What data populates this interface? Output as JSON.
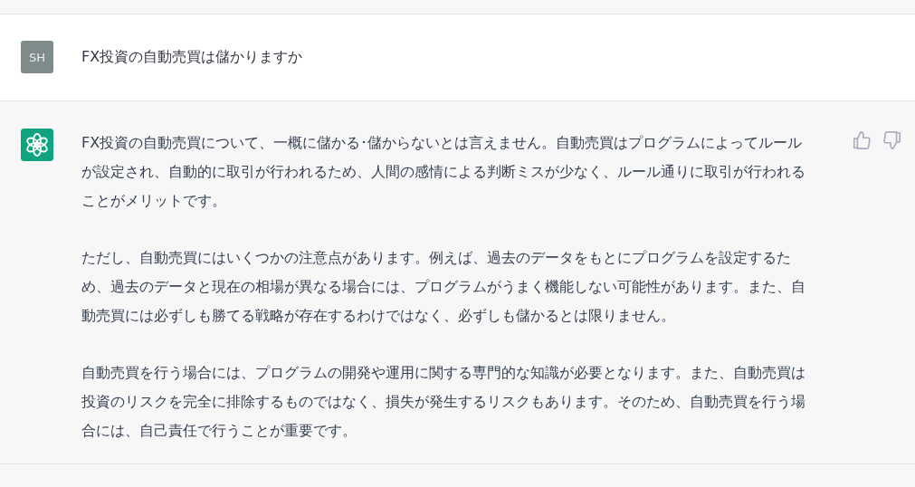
{
  "messages": [
    {
      "kind": "user",
      "avatar": "SH",
      "paragraphs": [
        "FX投資の自動売買は儲かりますか"
      ]
    },
    {
      "kind": "assistant",
      "paragraphs": [
        "FX投資の自動売買について、一概に儲かる･儲からないとは言えません。自動売買はプログラムによってルールが設定され、自動的に取引が行われるため、人間の感情による判断ミスが少なく、ルール通りに取引が行われることがメリットです。",
        "ただし、自動売買にはいくつかの注意点があります。例えば、過去のデータをもとにプログラムを設定するため、過去のデータと現在の相場が異なる場合には、プログラムがうまく機能しない可能性があります。また、自動売買には必ずしも勝てる戦略が存在するわけではなく、必ずしも儲かるとは限りません。",
        "自動売買を行う場合には、プログラムの開発や運用に関する専門的な知識が必要となります。また、自動売買は投資のリスクを完全に排除するものではなく、損失が発生するリスクもあります。そのため、自動売買を行う場合には、自己責任で行うことが重要です。"
      ]
    }
  ]
}
